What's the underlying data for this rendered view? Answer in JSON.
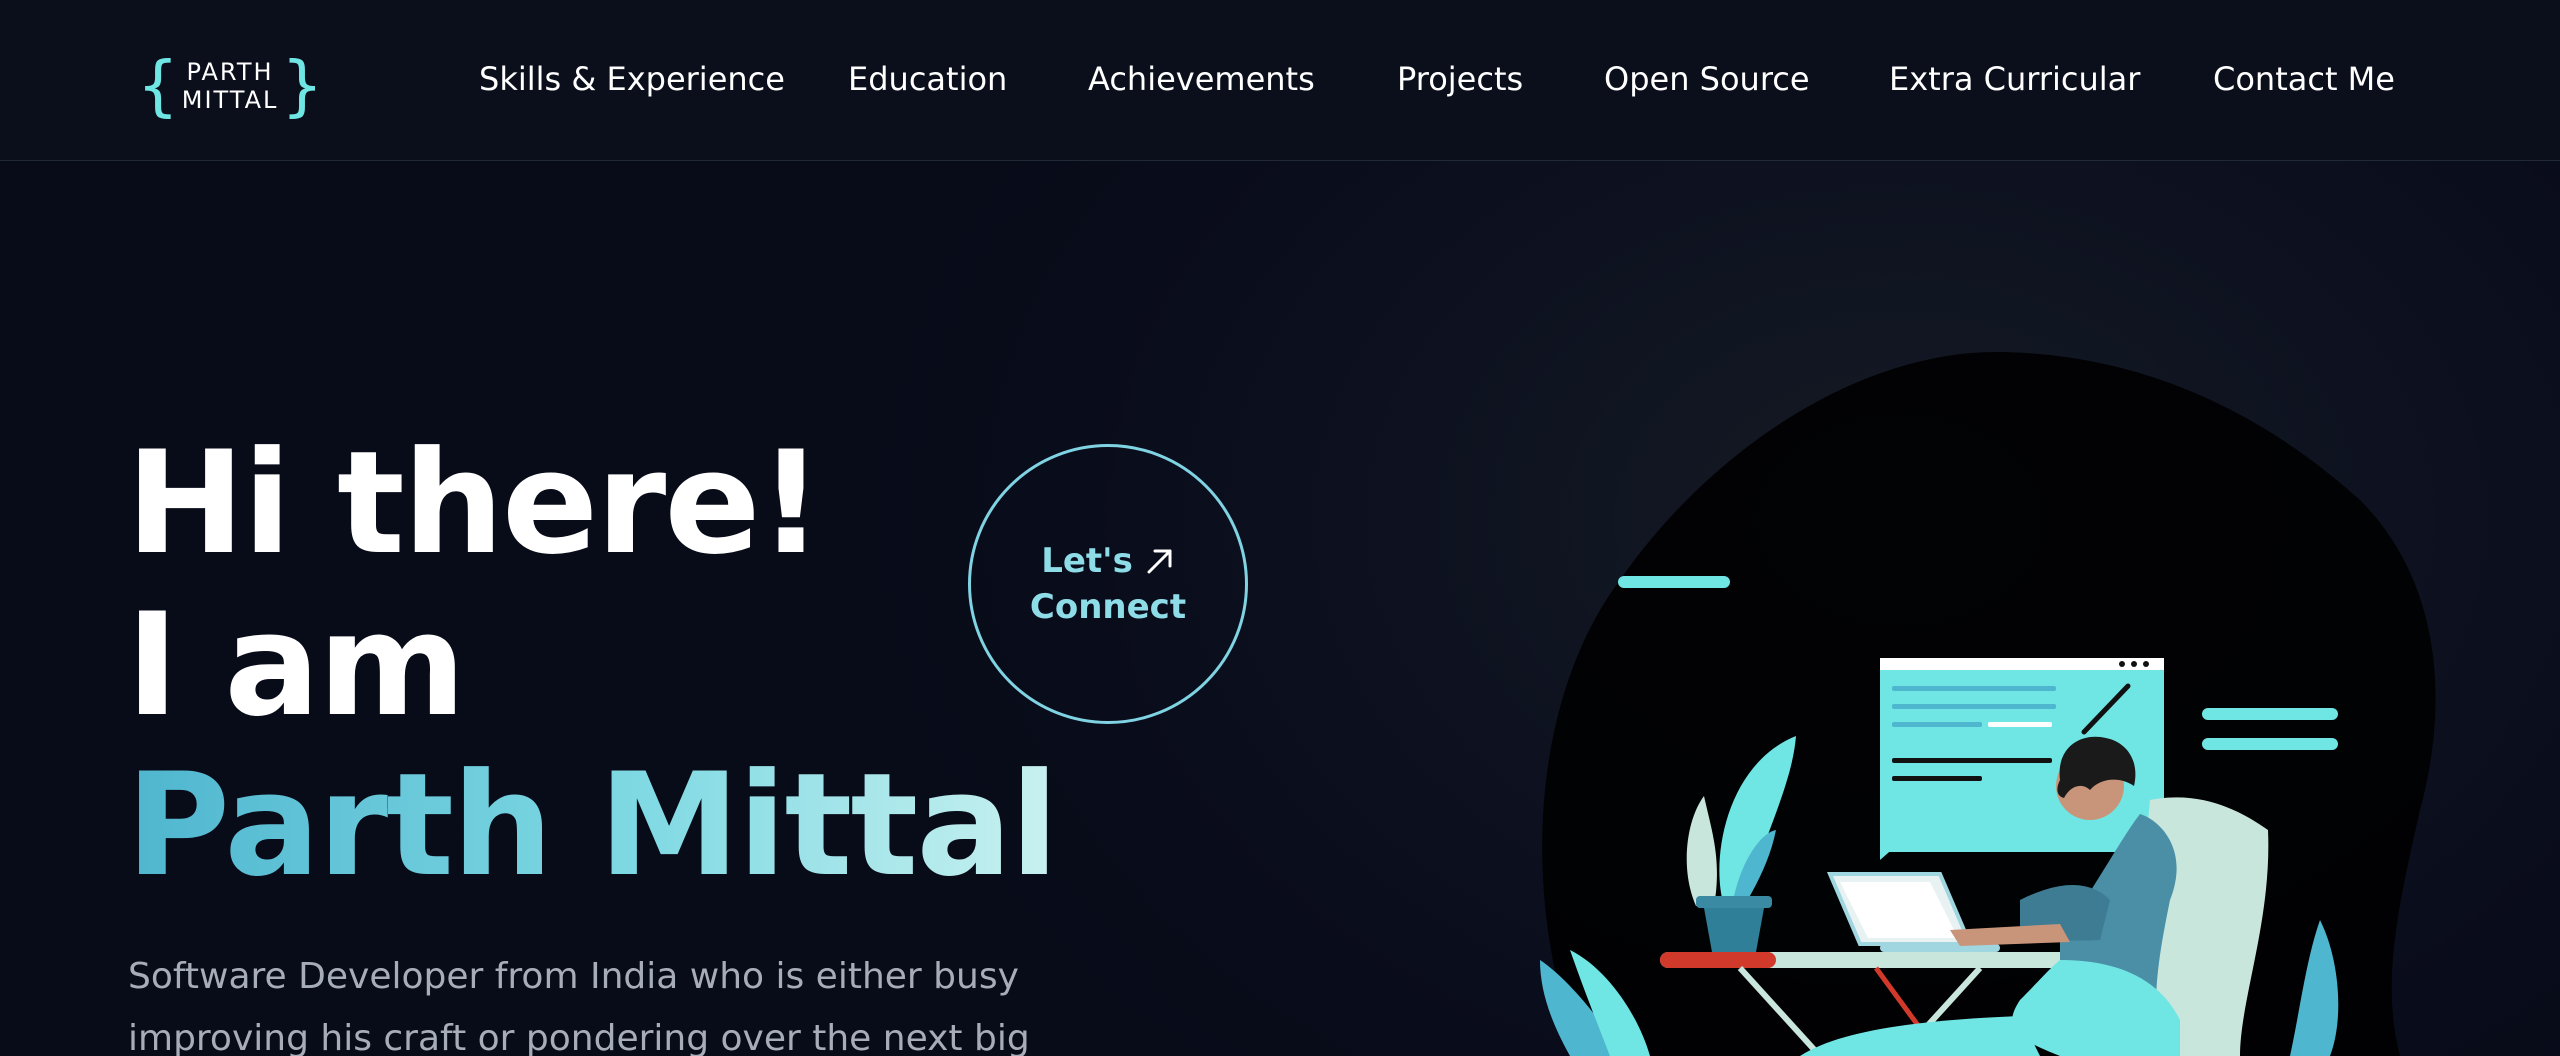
{
  "logo": {
    "line1": "PARTH",
    "line2": "MITTAL",
    "open_brace": "{",
    "close_brace": "}"
  },
  "nav": {
    "items": [
      {
        "label": "Skills & Experience"
      },
      {
        "label": "Education"
      },
      {
        "label": "Achievements"
      },
      {
        "label": "Projects"
      },
      {
        "label": "Open Source"
      },
      {
        "label": "Extra Curricular"
      },
      {
        "label": "Contact Me"
      }
    ]
  },
  "hero": {
    "line1": "Hi there!",
    "line2": "I am",
    "name": "Parth Mittal",
    "subtitle": "Software Developer from India who is either busy improving his craft or pondering over the next big"
  },
  "connect": {
    "line1": "Let's",
    "line2": "Connect",
    "icon": "arrow-up-right-icon"
  },
  "colors": {
    "accent": "#6fe6e4",
    "background": "#0a0d1a",
    "circle_border": "#7fd3e3",
    "subtitle": "#a7adb8"
  }
}
